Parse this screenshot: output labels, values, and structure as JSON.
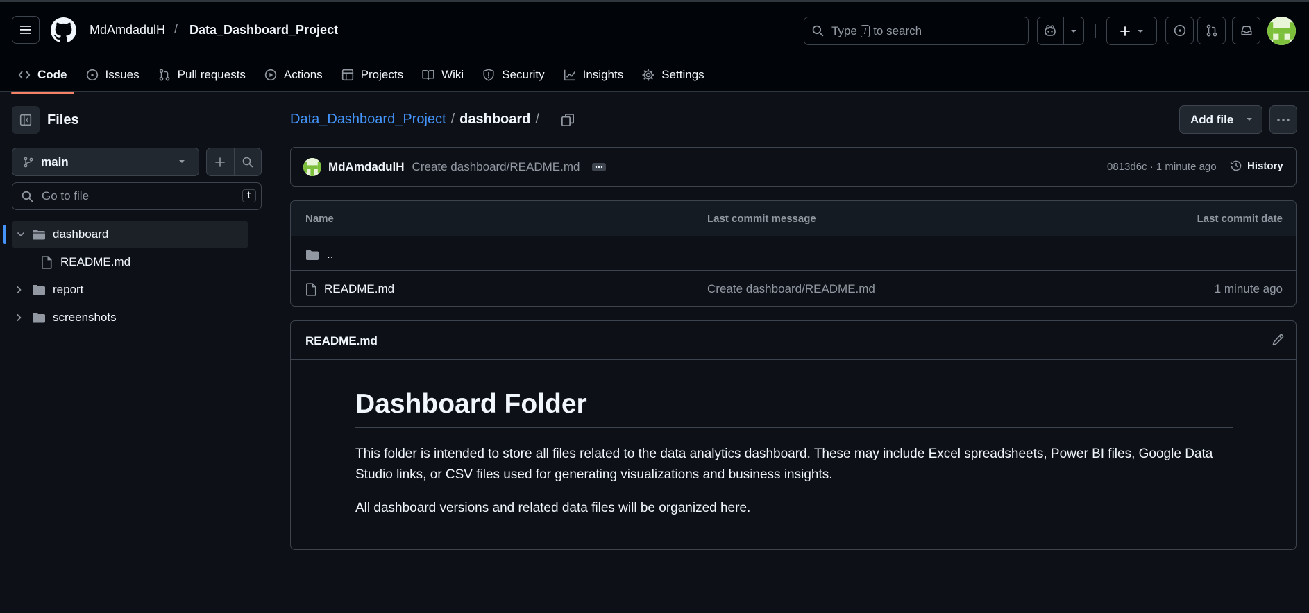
{
  "header": {
    "owner": "MdAmdadulH",
    "separator": "/",
    "repo": "Data_Dashboard_Project",
    "search_placeholder_pre": "Type",
    "search_key": "/",
    "search_placeholder_post": "to search"
  },
  "tabs": [
    {
      "label": "Code",
      "icon": "code-icon",
      "active": true
    },
    {
      "label": "Issues",
      "icon": "issue-icon"
    },
    {
      "label": "Pull requests",
      "icon": "pull-request-icon"
    },
    {
      "label": "Actions",
      "icon": "play-icon"
    },
    {
      "label": "Projects",
      "icon": "table-icon"
    },
    {
      "label": "Wiki",
      "icon": "book-icon"
    },
    {
      "label": "Security",
      "icon": "shield-icon"
    },
    {
      "label": "Insights",
      "icon": "graph-icon"
    },
    {
      "label": "Settings",
      "icon": "gear-icon"
    }
  ],
  "sidebar": {
    "title": "Files",
    "branch": "main",
    "goto_placeholder": "Go to file",
    "goto_key": "t",
    "tree": [
      {
        "label": "dashboard",
        "type": "folder",
        "expanded": true,
        "selected": true
      },
      {
        "label": "README.md",
        "type": "file"
      },
      {
        "label": "report",
        "type": "folder",
        "expanded": false
      },
      {
        "label": "screenshots",
        "type": "folder",
        "expanded": false
      }
    ]
  },
  "breadcrumb": {
    "repo": "Data_Dashboard_Project",
    "sep": "/",
    "current": "dashboard",
    "trail": "/"
  },
  "actions": {
    "add_file": "Add file"
  },
  "commit": {
    "author": "MdAmdadulH",
    "message": "Create dashboard/README.md",
    "hash_time": "0813d6c · 1 minute ago",
    "history": "History"
  },
  "table": {
    "headers": [
      "Name",
      "Last commit message",
      "Last commit date"
    ],
    "rows": [
      {
        "name": "..",
        "type": "folder",
        "message": "",
        "date": ""
      },
      {
        "name": "README.md",
        "type": "file",
        "message": "Create dashboard/README.md",
        "date": "1 minute ago"
      }
    ]
  },
  "readme": {
    "filename": "README.md",
    "heading": "Dashboard Folder",
    "paragraphs": [
      "This folder is intended to store all files related to the data analytics dashboard. These may include Excel spreadsheets, Power BI files, Google Data Studio links, or CSV files used for generating visualizations and business insights.",
      "All dashboard versions and related data files will be organized here."
    ]
  },
  "colors": {
    "background": "#0d1117",
    "header_bg": "#010409",
    "accent_link": "#4493f8",
    "tab_underline": "#f78166",
    "avatar_green": "#7bbf3a"
  }
}
